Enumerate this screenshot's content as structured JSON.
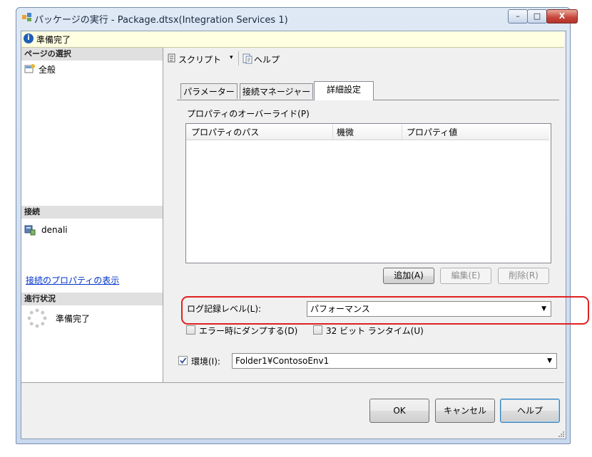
{
  "window": {
    "title": "パッケージの実行 - Package.dtsx(Integration Services 1)",
    "minimize": "–",
    "maximize": "□",
    "close": "X"
  },
  "status_bar": {
    "text": "準備完了"
  },
  "left_pane": {
    "page_select_header": "ページの選択",
    "page_general": "全般",
    "connection_header": "接続",
    "server_name": "denali",
    "connection_props_link": "接続のプロパティの表示",
    "progress_header": "進行状況",
    "progress_status": "準備完了"
  },
  "toolbar": {
    "script": "スクリプト",
    "script_arrow": "▾",
    "help": "ヘルプ"
  },
  "tabs": [
    {
      "label": "パラメーター"
    },
    {
      "label": "接続マネージャー"
    },
    {
      "label": "詳細設定"
    }
  ],
  "advanced": {
    "overrides_label": "プロパティのオーバーライド(P)",
    "columns": [
      "プロパティのパス",
      "機微",
      "プロパティ値"
    ],
    "add_button": "追加(A)",
    "edit_button": "編集(E)",
    "delete_button": "削除(R)",
    "log_level_label": "ログ記録レベル(L):",
    "log_level_value": "パフォーマンス",
    "dump_on_error_label": "エラー時にダンプする(D)",
    "runtime32_label": "32 ビット ランタイム(U)"
  },
  "environment": {
    "label": "環境(I):",
    "value": "Folder1¥ContosoEnv1"
  },
  "footer": {
    "ok": "OK",
    "cancel": "キャンセル",
    "help": "ヘルプ"
  },
  "colors": {
    "highlight": "#e02020",
    "infobar": "#ffffe1",
    "link": "#0033cc"
  }
}
